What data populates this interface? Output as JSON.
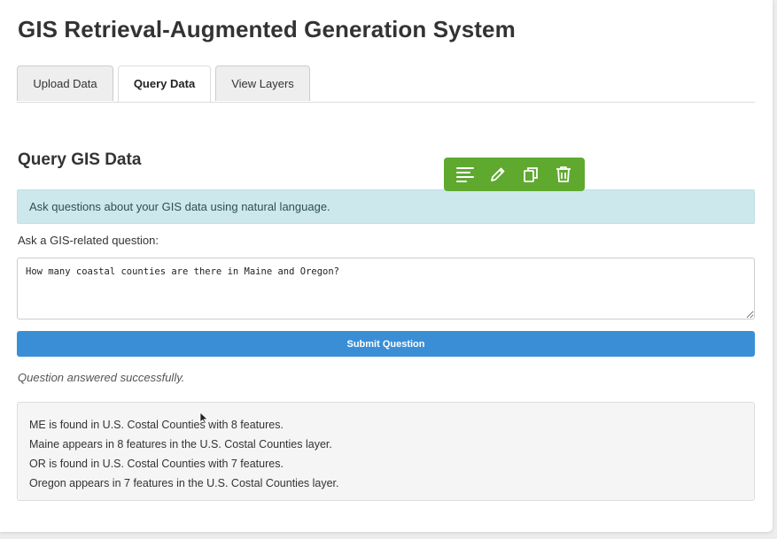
{
  "app": {
    "title": "GIS Retrieval-Augmented Generation System"
  },
  "tabs": [
    {
      "label": "Upload Data",
      "active": false
    },
    {
      "label": "Query Data",
      "active": true
    },
    {
      "label": "View Layers",
      "active": false
    }
  ],
  "query_section": {
    "title": "Query GIS Data",
    "info": "Ask questions about your GIS data using natural language.",
    "question_label": "Ask a GIS-related question:",
    "question_value": "How many coastal counties are there in Maine and Oregon?",
    "submit_label": "Submit Question",
    "status": "Question answered successfully.",
    "answer_lines": [
      "ME is found in U.S. Costal Counties with 8 features.",
      "Maine appears in 8 features in the U.S. Costal Counties layer.",
      "OR is found in U.S. Costal Counties with 7 features.",
      "Oregon appears in 7 features in the U.S. Costal Counties layer."
    ]
  },
  "floating_toolbar": {
    "icons": [
      "align-left-icon",
      "pencil-icon",
      "copy-icon",
      "trash-icon"
    ],
    "color": "#5fa92f"
  },
  "colors": {
    "accent": "#3a8ed6",
    "info_bg": "#cde8ec",
    "answer_bg": "#f5f5f5"
  }
}
